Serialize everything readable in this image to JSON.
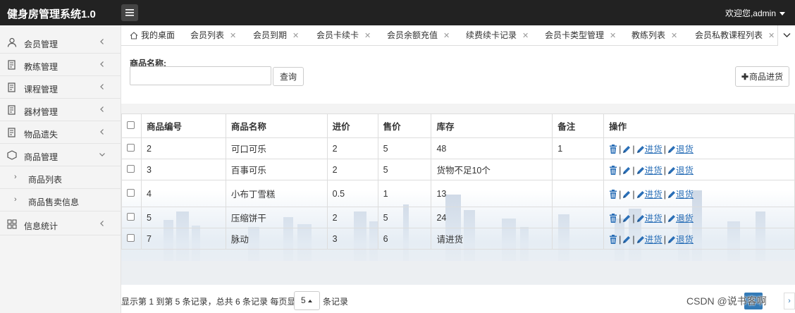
{
  "header": {
    "brand": "健身房管理系统1.0",
    "user_greeting": "欢迎您,admin"
  },
  "sidebar": {
    "items": [
      {
        "label": "会员管理",
        "icon": "user-icon"
      },
      {
        "label": "教练管理",
        "icon": "doc-icon"
      },
      {
        "label": "课程管理",
        "icon": "doc-icon"
      },
      {
        "label": "器材管理",
        "icon": "doc-icon"
      },
      {
        "label": "物品遗失",
        "icon": "doc-icon"
      },
      {
        "label": "商品管理",
        "icon": "box-icon",
        "expanded": true
      },
      {
        "label": "信息统计",
        "icon": "grid-icon"
      }
    ],
    "subitems": [
      {
        "label": "商品列表"
      },
      {
        "label": "商品售卖信息"
      }
    ]
  },
  "tabs": [
    {
      "label": "我的桌面",
      "home": true
    },
    {
      "label": "会员列表"
    },
    {
      "label": "会员到期"
    },
    {
      "label": "会员卡续卡"
    },
    {
      "label": "会员余额充值"
    },
    {
      "label": "续费续卡记录"
    },
    {
      "label": "会员卡类型管理"
    },
    {
      "label": "教练列表"
    },
    {
      "label": "会员私教课程列表"
    }
  ],
  "search": {
    "label": "商品名称:",
    "value": "",
    "placeholder": "",
    "button_label": "查询"
  },
  "toolbar": {
    "add_label": "商品进货"
  },
  "table": {
    "columns": [
      "商品编号",
      "商品名称",
      "进价",
      "售价",
      "库存",
      "备注",
      "操作"
    ],
    "rows": [
      {
        "id": "2",
        "name": "可口可乐",
        "cost": "2",
        "price": "5",
        "stock": "48",
        "stock_warning": false,
        "note": "1"
      },
      {
        "id": "3",
        "name": "百事可乐",
        "cost": "2",
        "price": "5",
        "stock": "货物不足10个",
        "stock_warning": true,
        "note": ""
      },
      {
        "id": "4",
        "name": "小布丁雪糕",
        "cost": "0.5",
        "price": "1",
        "stock": "13",
        "stock_warning": false,
        "note": ""
      },
      {
        "id": "5",
        "name": "压缩饼干",
        "cost": "2",
        "price": "5",
        "stock": "24",
        "stock_warning": false,
        "note": ""
      },
      {
        "id": "7",
        "name": "脉动",
        "cost": "3",
        "price": "6",
        "stock": "请进货",
        "stock_warning": true,
        "note": ""
      }
    ],
    "actions": {
      "restock": "进货",
      "return": "退货"
    }
  },
  "pagination": {
    "info": "显示第 1 到第 5 条记录，总共 6 条记录 每页显示",
    "page_size": "5",
    "per_page_suffix": "条记录"
  },
  "watermark": "CSDN @说书客啊",
  "colors": {
    "topbar": "#222222",
    "warning_text": "#e0201a",
    "link": "#2a6fb7"
  }
}
